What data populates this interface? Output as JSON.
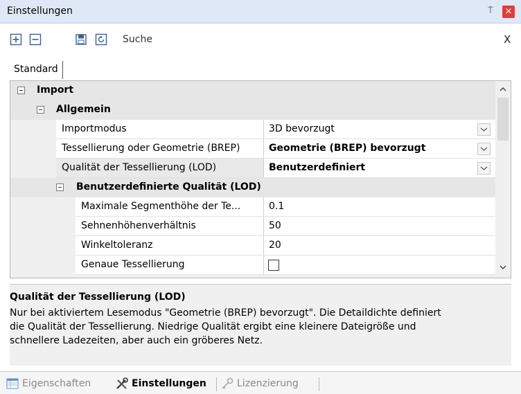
{
  "window": {
    "title": "Einstellungen",
    "pin_glyph": "⍑",
    "close_glyph": "×",
    "close_color": "#e23b3b"
  },
  "toolbar": {
    "icons": [
      "expand-all-icon",
      "collapse-all-icon",
      "save-icon",
      "reset-icon"
    ],
    "search_label": "Suche",
    "clear_label": "X"
  },
  "tabs": {
    "active": "Standard"
  },
  "grid": {
    "category_import": "Import",
    "category_allgemein": "Allgemein",
    "properties": [
      {
        "name": "Importmodus",
        "value": "3D bevorzugt"
      },
      {
        "name": "Tessellierung oder Geometrie (BREP)",
        "value": "Geometrie (BREP) bevorzugt"
      },
      {
        "name": "Qualität der Tessellierung (LOD)",
        "value": "Benutzerdefiniert"
      }
    ],
    "category_custom": "Benutzerdefinierte Qualität (LOD)",
    "custom_properties": [
      {
        "name": "Maximale Segmenthöhe der Te...",
        "value": "0.1"
      },
      {
        "name": "Sehnenhöhenverhältnis",
        "value": "50"
      },
      {
        "name": "Winkeltoleranz",
        "value": "20"
      },
      {
        "name": "Genaue Tessellierung",
        "value": ""
      }
    ],
    "genaue_tessellierung_checked": false
  },
  "description": {
    "title": "Qualität der Tessellierung (LOD)",
    "line1": "Nur bei aktiviertem Lesemodus \"Geometrie (BREP) bevorzugt\". Die Detaildichte definiert",
    "line2": "die Qualität der Tessellierung. Niedrige Qualität ergibt eine kleinere Dateigröße und",
    "line3": "schnellere Ladezeiten, aber auch ein gröberes Netz."
  },
  "bottom_tabs": [
    {
      "label": "Eigenschaften",
      "icon": "properties-icon",
      "active": false
    },
    {
      "label": "Einstellungen",
      "icon": "tools-icon",
      "active": true
    },
    {
      "label": "Lizenzierung",
      "icon": "key-icon",
      "active": false
    }
  ]
}
